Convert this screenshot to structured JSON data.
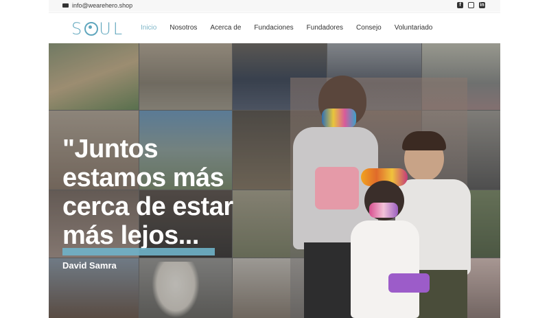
{
  "topbar": {
    "email": "info@wearehero.shop",
    "social_icons": [
      "facebook-icon",
      "instagram-icon",
      "linkedin-icon"
    ]
  },
  "header": {
    "logo_text": "SOUL",
    "nav": [
      {
        "label": "Inicio",
        "active": true
      },
      {
        "label": "Nosotros",
        "active": false
      },
      {
        "label": "Acerca de",
        "active": false
      },
      {
        "label": "Fundaciones",
        "active": false
      },
      {
        "label": "Fundadores",
        "active": false
      },
      {
        "label": "Consejo",
        "active": false
      },
      {
        "label": "Voluntariado",
        "active": false
      }
    ]
  },
  "hero": {
    "quote_lines": [
      "\"Juntos",
      "estamos más",
      "cerca de estar",
      "más lejos..."
    ],
    "author": "David Samra",
    "accent_color": "#6fb2c9"
  }
}
